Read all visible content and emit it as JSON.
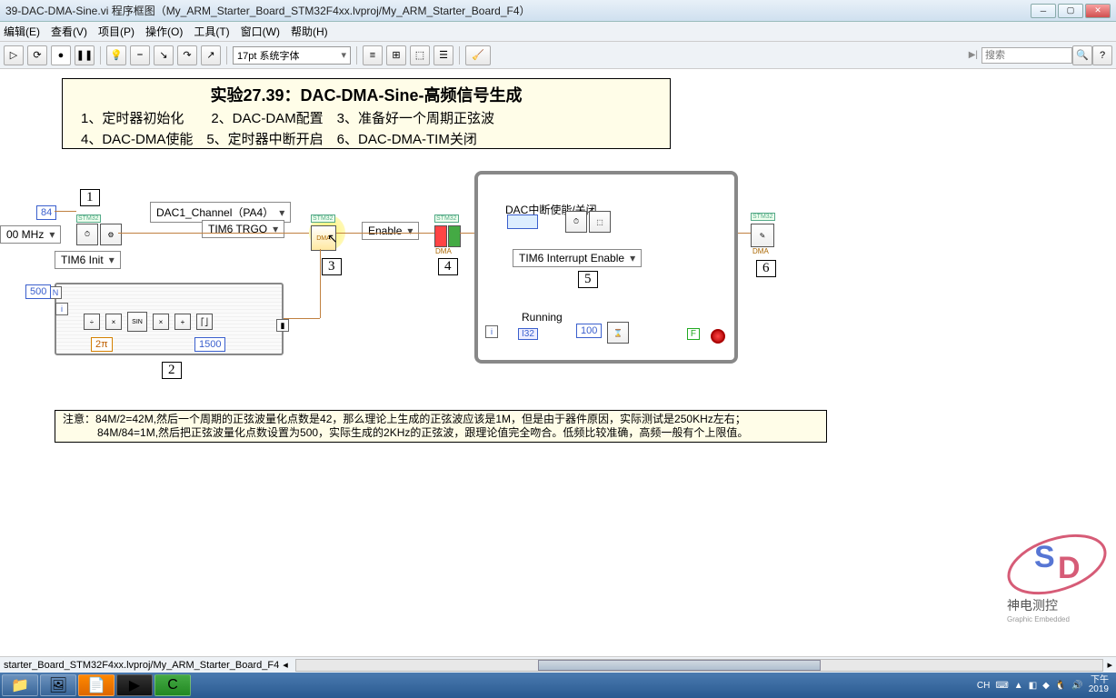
{
  "window": {
    "title": "39-DAC-DMA-Sine.vi 程序框图（My_ARM_Starter_Board_STM32F4xx.lvproj/My_ARM_Starter_Board_F4）"
  },
  "menu": {
    "edit": "编辑(E)",
    "view": "查看(V)",
    "project": "项目(P)",
    "operate": "操作(O)",
    "tools": "工具(T)",
    "window": "窗口(W)",
    "help": "帮助(H)"
  },
  "toolbar": {
    "font": "17pt 系统字体",
    "search_placeholder": "搜索"
  },
  "info": {
    "title": "实验27.39：DAC-DMA-Sine-高频信号生成",
    "line1": "1、定时器初始化　　2、DAC-DAM配置　3、准备好一个周期正弦波",
    "line2": "4、DAC-DMA使能　5、定时器中断开启　6、DAC-DMA-TIM关闭"
  },
  "labels": {
    "num1": "1",
    "num2": "2",
    "num3": "3",
    "num4": "4",
    "num5": "5",
    "num6": "6"
  },
  "constants": {
    "c84": "84",
    "c00mhz": "00 MHz",
    "c500": "500",
    "c2pi": "2π",
    "c1500": "1500",
    "c100": "100",
    "cF": "F",
    "cI32": "I32"
  },
  "selects": {
    "tim6_init": "TIM6 Init",
    "dac1_chan": "DAC1_Channel（PA4）",
    "tim6_trgo": "TIM6 TRGO",
    "enable": "Enable",
    "tim6_int": "TIM6 Interrupt Enable"
  },
  "text": {
    "dac_int_label": "DAC中断使能/关闭",
    "running": "Running",
    "stm32": "STM32",
    "dma": "DMA",
    "n": "N",
    "i": "i",
    "sin": "SIN"
  },
  "note": {
    "line1": "注意：84M/2=42M,然后一个周期的正弦波量化点数是42，那么理论上生成的正弦波应该是1M，但是由于器件原因，实际测试是250KHz左右；",
    "line2": "84M/84=1M,然后把正弦波量化点数设置为500，实际生成的2KHz的正弦波，跟理论值完全吻合。低频比较准确，高频一般有个上限值。"
  },
  "footer": {
    "path": "starter_Board_STM32F4xx.lvproj/My_ARM_Starter_Board_F4",
    "ime": "CH",
    "time": "下午",
    "year": "2019"
  },
  "watermark": {
    "text1": "神电测控",
    "text2": "Graphic Embedded"
  }
}
